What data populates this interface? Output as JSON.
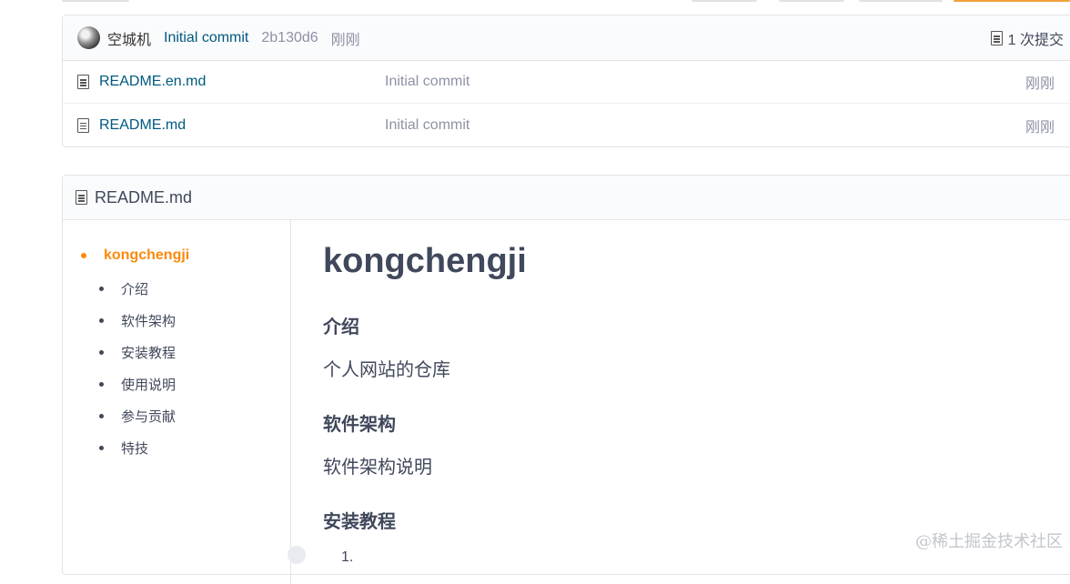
{
  "commit": {
    "author": "空城机",
    "message": "Initial commit",
    "sha": "2b130d6",
    "time": "刚刚",
    "count_label": "1 次提交",
    "count_icon": "doc-icon"
  },
  "files": [
    {
      "name": "README.en.md",
      "message": "Initial commit",
      "time": "刚刚",
      "icon": "file-icon"
    },
    {
      "name": "README.md",
      "message": "Initial commit",
      "time": "刚刚",
      "icon": "file-icon"
    }
  ],
  "readme": {
    "filename": "README.md",
    "toc": {
      "root": "kongchengji",
      "items": [
        "介绍",
        "软件架构",
        "安装教程",
        "使用说明",
        "参与贡献",
        "特技"
      ]
    },
    "title": "kongchengji",
    "sections": [
      {
        "heading": "介绍",
        "body": "个人网站的仓库"
      },
      {
        "heading": "软件架构",
        "body": "软件架构说明"
      },
      {
        "heading": "安装教程",
        "body": ""
      }
    ],
    "list_start": "1."
  },
  "colors": {
    "accent": "#fb8a0d",
    "link": "#005980",
    "muted": "#8c92a4",
    "text": "#40485b"
  },
  "watermark": "@稀土掘金技术社区"
}
